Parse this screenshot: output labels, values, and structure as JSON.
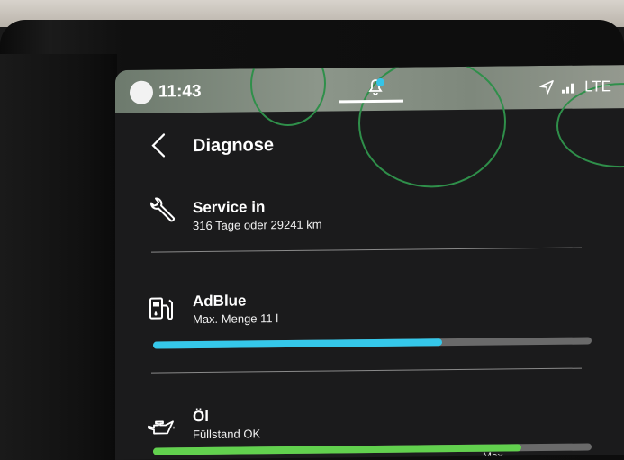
{
  "status": {
    "time": "11:43",
    "network": "LTE",
    "accent": "#35c4e8"
  },
  "header": {
    "title": "Diagnose"
  },
  "items": [
    {
      "id": "service",
      "icon": "wrench-icon",
      "title": "Service in",
      "subtitle": "316 Tage oder 29241 km"
    },
    {
      "id": "adblue",
      "icon": "fuel-pump-icon",
      "title": "AdBlue",
      "subtitle": "Max. Menge 11 l",
      "level": 0.66,
      "bar_color": "#35c8ea"
    },
    {
      "id": "oil",
      "icon": "oil-can-icon",
      "title": "Öl",
      "subtitle": "Füllstand OK",
      "level": 0.84,
      "bar_color": "#62d14e",
      "max_label": "Max."
    }
  ]
}
